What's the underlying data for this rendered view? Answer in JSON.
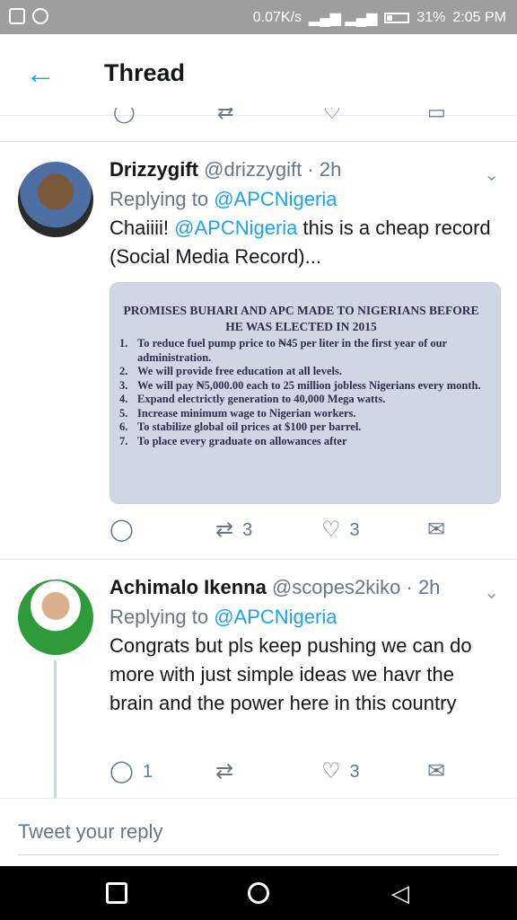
{
  "status_bar": {
    "speed": "0.07K/s",
    "battery": "31%",
    "time": "2:05 PM",
    "icons": [
      "image-icon",
      "whatsapp-icon",
      "signal-icon",
      "battery-icon"
    ]
  },
  "header": {
    "title": "Thread",
    "back_icon": "←"
  },
  "tweets": [
    {
      "name": "Drizzygift",
      "handle": "@drizzygift",
      "time": "· 2h",
      "replying_prefix": "Replying to ",
      "replying_to": "@APCNigeria",
      "text_prefix": "Chaiiii! ",
      "text_mention": "@APCNigeria",
      "text_suffix": " this is a cheap record (Social Media Record)...",
      "media": {
        "title": "PROMISES BUHARI AND APC MADE TO NIGERIANS BEFORE HE WAS ELECTED IN 2015",
        "items": [
          {
            "n": "1.",
            "t": "To reduce fuel pump price to ₦45 per liter in the first year of our administration."
          },
          {
            "n": "2.",
            "t": "We will provide free education at all levels."
          },
          {
            "n": "3.",
            "t": "We will pay ₦5,000.00 each to 25 million jobless Nigerians every month."
          },
          {
            "n": "4.",
            "t": "Expand electrictly generation to 40,000 Mega watts."
          },
          {
            "n": "5.",
            "t": "Increase minimum wage to Nigerian workers."
          },
          {
            "n": "6.",
            "t": "To stabilize global oil prices at $100 per barrel."
          },
          {
            "n": "7.",
            "t": "To place every graduate on allowances after"
          }
        ]
      },
      "replies": "",
      "retweets": "3",
      "likes": "3"
    },
    {
      "name": "Achimalo Ikenna",
      "handle": "@scopes2kiko",
      "time": "· 2h",
      "replying_prefix": "Replying to ",
      "replying_to": "@APCNigeria",
      "text": "Congrats but pls keep pushing we can do more with just simple ideas we havr the brain and the power here in this country",
      "replies": "1",
      "retweets": "",
      "likes": "3"
    }
  ],
  "compose": {
    "placeholder": "Tweet your reply"
  },
  "colors": {
    "accent": "#1da1f2",
    "secondary_text": "#657786",
    "status_bar": "#9e9e9e"
  }
}
